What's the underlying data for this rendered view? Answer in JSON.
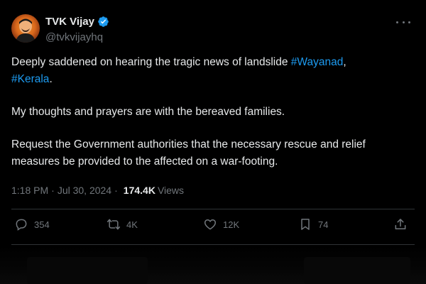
{
  "author": {
    "display_name": "TVK Vijay",
    "handle": "@tvkvijayhq",
    "verified_color": "#1d9bf0"
  },
  "menu": {
    "icon": "more-horizontal-icon"
  },
  "tweet": {
    "line1_text": "Deeply saddened on hearing the tragic news of landslide ",
    "hashtag1": "#Wayanad",
    "comma": ",",
    "hashtag2": "#Kerala",
    "period": ".",
    "paragraph2": "My thoughts and prayers are with the bereaved families.",
    "paragraph3": "Request the Government authorities that the necessary rescue and relief measures be provided to the affected on a war-footing."
  },
  "meta": {
    "time": "1:18 PM",
    "separator": "·",
    "date": "Jul 30, 2024",
    "views_count": "174.4K",
    "views_label": "Views"
  },
  "actions": {
    "reply": {
      "count": "354",
      "icon": "reply-icon"
    },
    "retweet": {
      "count": "4K",
      "icon": "retweet-icon"
    },
    "like": {
      "count": "12K",
      "icon": "heart-icon"
    },
    "bookmark": {
      "count": "74",
      "icon": "bookmark-icon"
    },
    "share": {
      "icon": "share-icon"
    }
  },
  "colors": {
    "background": "#000000",
    "text": "#e7e9ea",
    "muted": "#71767b",
    "link": "#1d9bf0",
    "divider": "#2f3336"
  }
}
